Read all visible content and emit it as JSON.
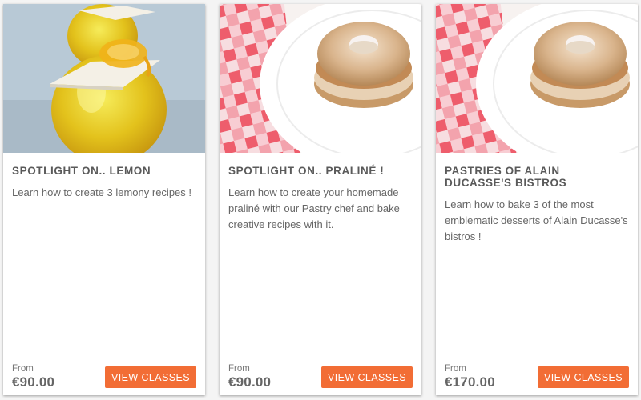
{
  "cards": [
    {
      "title": "SPOTLIGHT ON.. LEMON",
      "description": "Learn how to create 3 lemony recipes !",
      "price_from_label": "From",
      "price": "€90.00",
      "button_label": "VIEW CLASSES",
      "image": "lemon-dessert-photo"
    },
    {
      "title": "SPOTLIGHT ON.. PRALINÉ !",
      "description": "Learn how to create your homemade praliné with our Pastry chef and bake creative recipes with it.",
      "price_from_label": "From",
      "price": "€90.00",
      "button_label": "VIEW CLASSES",
      "image": "paris-brest-pastry-photo"
    },
    {
      "title": "PASTRIES OF ALAIN DUCASSE'S BISTROS",
      "description": "Learn how to bake 3 of the most emblematic desserts of Alain Ducasse's bistros !",
      "price_from_label": "From",
      "price": "€170.00",
      "button_label": "VIEW CLASSES",
      "image": "paris-brest-pastry-photo"
    }
  ],
  "colors": {
    "accent": "#f26d35",
    "card_background": "#ffffff",
    "page_background": "#f4f4f4"
  }
}
